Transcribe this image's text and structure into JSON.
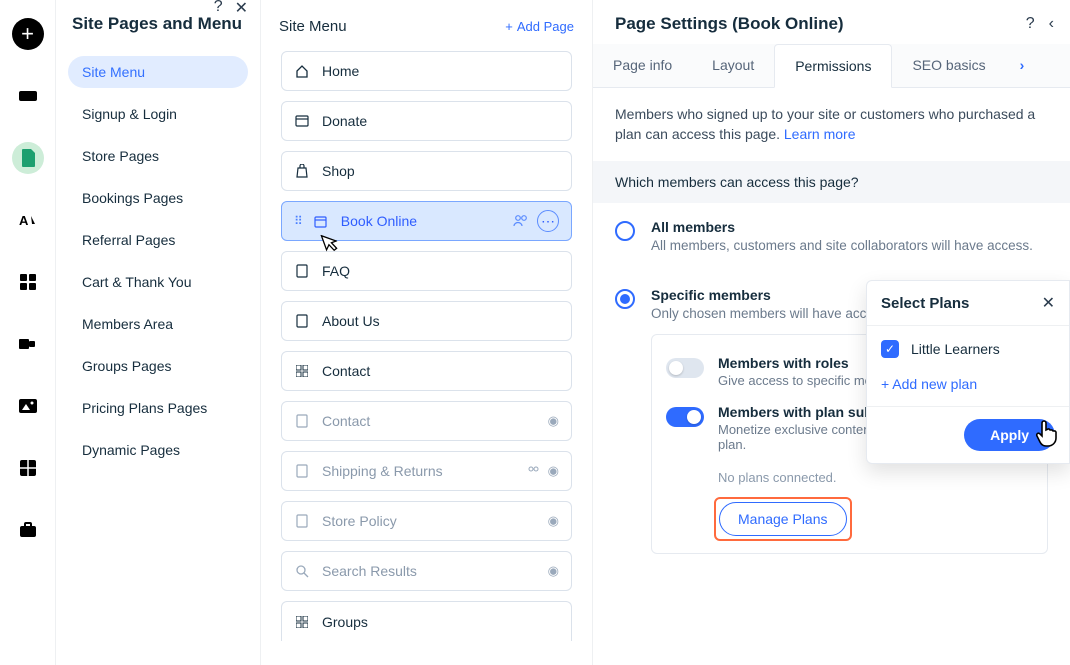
{
  "left_panel": {
    "title": "Site Pages and Menu",
    "categories": [
      "Site Menu",
      "Signup & Login",
      "Store Pages",
      "Bookings Pages",
      "Referral Pages",
      "Cart & Thank You",
      "Members Area",
      "Groups Pages",
      "Pricing Plans Pages",
      "Dynamic Pages"
    ]
  },
  "mid_panel": {
    "title": "Site Menu",
    "add_page": "Add Page",
    "pages": [
      {
        "label": "Home"
      },
      {
        "label": "Donate"
      },
      {
        "label": "Shop"
      },
      {
        "label": "Book Online"
      },
      {
        "label": "FAQ"
      },
      {
        "label": "About Us"
      },
      {
        "label": "Contact"
      },
      {
        "label": "Contact"
      },
      {
        "label": "Shipping & Returns"
      },
      {
        "label": "Store Policy"
      },
      {
        "label": "Search Results"
      },
      {
        "label": "Groups"
      }
    ]
  },
  "right_panel": {
    "title": "Page Settings (Book Online)",
    "tabs": [
      "Page info",
      "Layout",
      "Permissions",
      "SEO basics"
    ],
    "description": "Members who signed up to your site or customers who purchased a plan can access this page. ",
    "learn_more": "Learn more",
    "section_header": "Which members can access this page?",
    "radio_all_title": "All members",
    "radio_all_sub": "All members, customers and site collaborators will have access.",
    "radio_specific_title": "Specific members",
    "radio_specific_sub": "Only chosen members will have access.",
    "roles_title": "Members with roles",
    "roles_sub": "Give access to specific member roles.",
    "plans_title": "Members with plan subscriptions",
    "plans_sub": "Monetize exclusive content to customers with a pricing plan.",
    "no_plans": "No plans connected.",
    "manage_plans": "Manage Plans"
  },
  "popup": {
    "title": "Select Plans",
    "plan_name": "Little Learners",
    "add_new": "+ Add new plan",
    "apply": "Apply"
  },
  "icons": {
    "help": "?",
    "close": "✕",
    "chevron_right": "›",
    "chevron_left": "‹",
    "plus": "+",
    "check": "✓",
    "dots": "⋯"
  }
}
